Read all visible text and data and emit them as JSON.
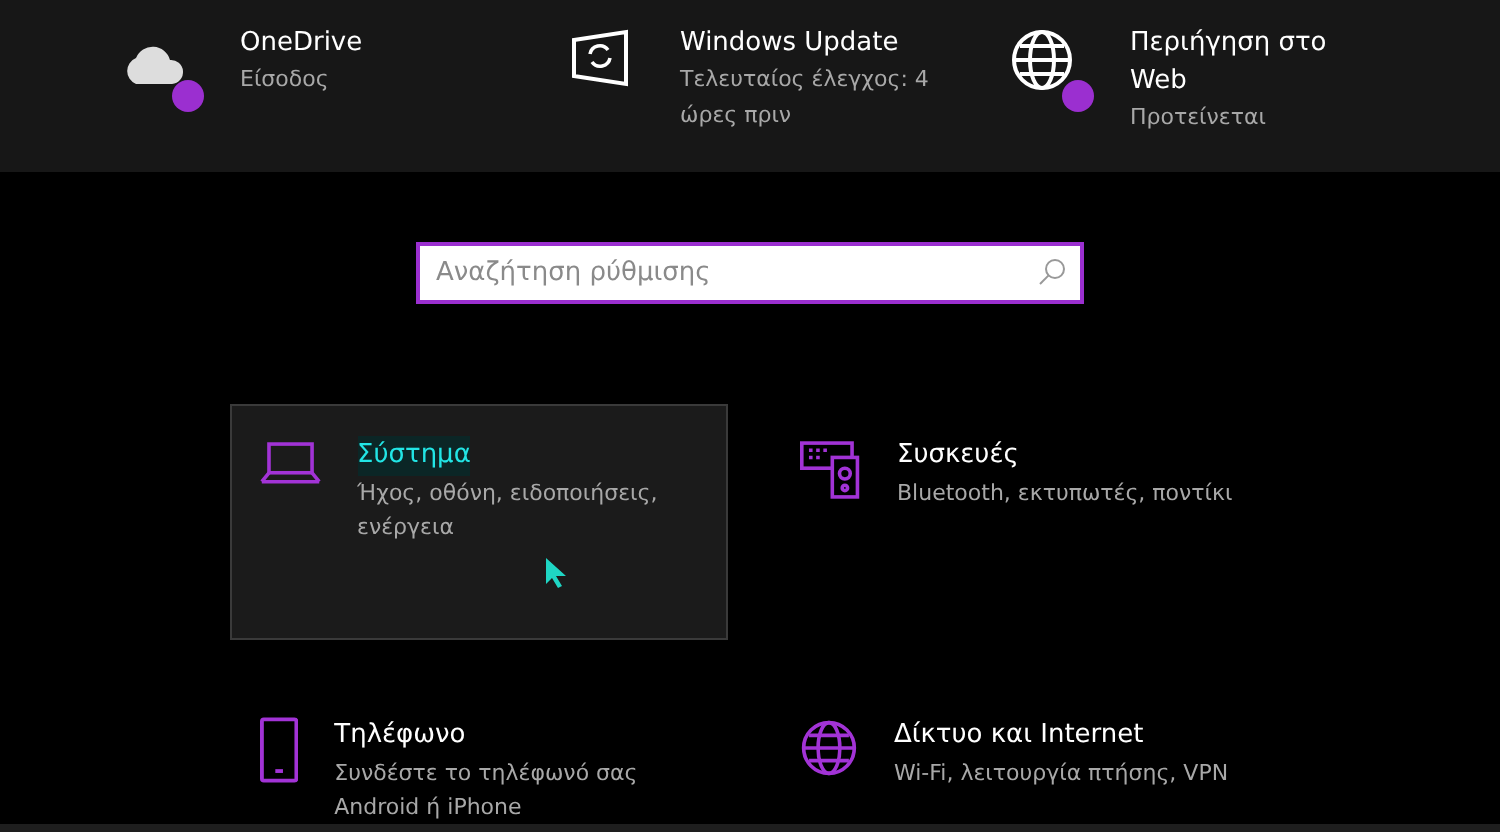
{
  "top_bar": [
    {
      "kind": "cloud",
      "title": "OneDrive",
      "subtitle": "Είσοδος",
      "badge": true
    },
    {
      "kind": "update",
      "title": "Windows Update",
      "subtitle": "Τελευταίος έλεγχος: 4 ώρες πριν",
      "badge": false
    },
    {
      "kind": "globe",
      "title": "Περιήγηση στο Web",
      "subtitle": "Προτείνεται",
      "badge": true
    }
  ],
  "search": {
    "placeholder": "Αναζήτηση ρύθμισης"
  },
  "categories": [
    {
      "kind": "laptop",
      "title": "Σύστημα",
      "subtitle": "Ήχος, οθόνη, ειδοποιήσεις, ενέργεια",
      "selected": true
    },
    {
      "kind": "devices",
      "title": "Συσκευές",
      "subtitle": "Bluetooth, εκτυπωτές, ποντίκι",
      "selected": false
    },
    {
      "kind": "phone",
      "title": "Τηλέφωνο",
      "subtitle": "Συνδέστε το τηλέφωνό σας Android ή iPhone",
      "selected": false
    },
    {
      "kind": "globe",
      "title": "Δίκτυο και Internet",
      "subtitle": "Wi-Fi, λειτουργία πτήσης, VPN",
      "selected": false
    }
  ]
}
